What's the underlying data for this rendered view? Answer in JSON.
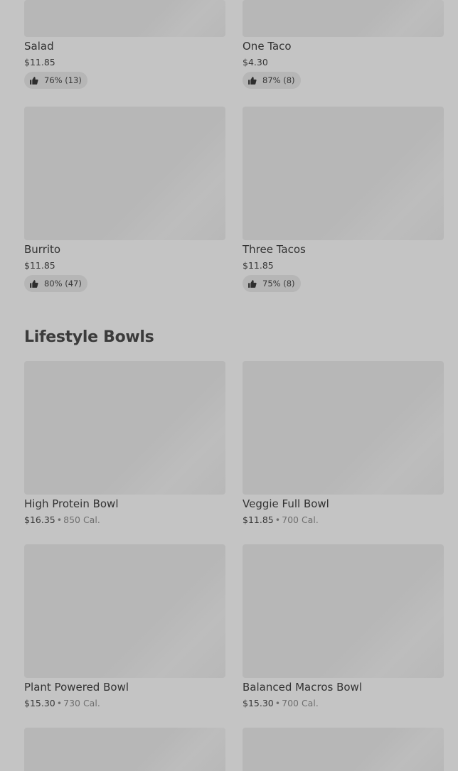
{
  "top_items": [
    {
      "name": "Salad",
      "price": "$11.85",
      "rating": "76% (13)"
    },
    {
      "name": "One Taco",
      "price": "$4.30",
      "rating": "87% (8)"
    },
    {
      "name": "Burrito",
      "price": "$11.85",
      "rating": "80% (47)"
    },
    {
      "name": "Three Tacos",
      "price": "$11.85",
      "rating": "75% (8)"
    }
  ],
  "section": {
    "title": "Lifestyle Bowls"
  },
  "bowls": [
    {
      "name": "High Protein Bowl",
      "price": "$16.35",
      "separator": "•",
      "calories": "850 Cal."
    },
    {
      "name": "Veggie Full Bowl",
      "price": "$11.85",
      "separator": "•",
      "calories": "700 Cal."
    },
    {
      "name": "Plant Powered Bowl",
      "price": "$15.30",
      "separator": "•",
      "calories": "730 Cal."
    },
    {
      "name": "Balanced Macros Bowl",
      "price": "$15.30",
      "separator": "•",
      "calories": "700 Cal."
    }
  ],
  "icons": {
    "rating": "thumbs-up-icon"
  },
  "colors": {
    "background": "#c4c4c4",
    "image_placeholder": "#b7b7b7",
    "rating_pill": "#b6b6b6"
  }
}
